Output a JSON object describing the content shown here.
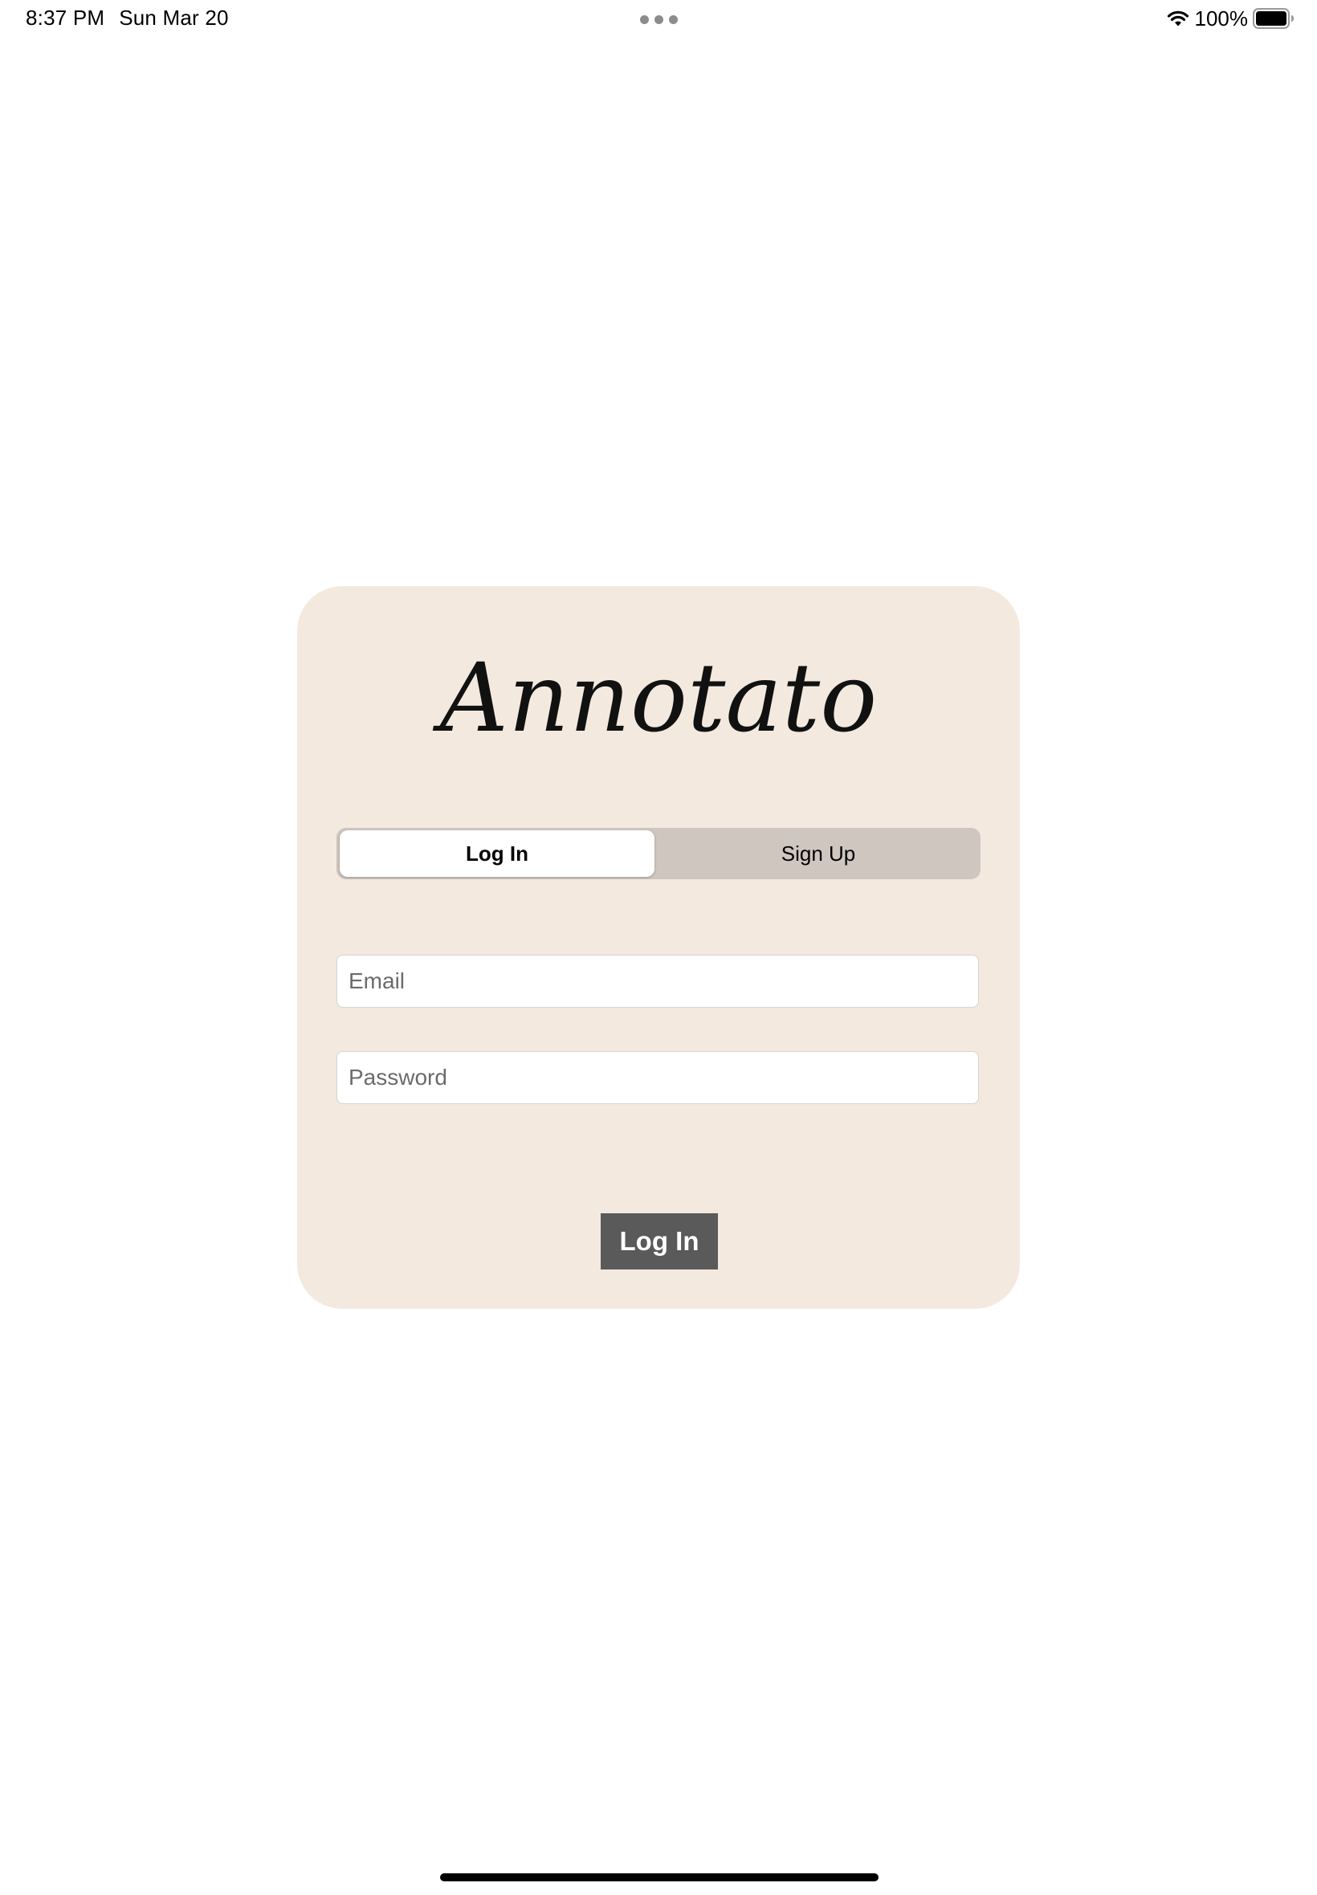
{
  "status_bar": {
    "time": "8:37 PM",
    "date": "Sun Mar 20",
    "battery": "100%",
    "icons": [
      "wifi-icon",
      "battery-icon",
      "multitask-dots-icon"
    ]
  },
  "app": {
    "logo_text": "Annotato"
  },
  "auth": {
    "tabs": [
      {
        "label": "Log In",
        "selected": true
      },
      {
        "label": "Sign Up",
        "selected": false
      }
    ],
    "email": {
      "placeholder": "Email",
      "value": ""
    },
    "password": {
      "placeholder": "Password",
      "value": ""
    },
    "submit_label": "Log In"
  },
  "colors": {
    "card_background": "#f3e9de",
    "segment_background": "#cfc6c0",
    "button_background": "#5a5a5a",
    "button_text": "#ffffff"
  }
}
